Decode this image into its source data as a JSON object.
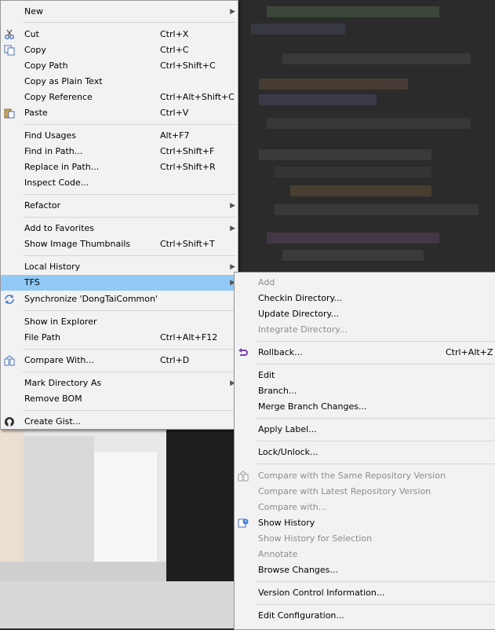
{
  "main_menu": {
    "items": [
      {
        "label": "New",
        "has_submenu": true
      },
      {
        "label": "Cut",
        "shortcut": "Ctrl+X",
        "icon": "scissors-icon"
      },
      {
        "label": "Copy",
        "shortcut": "Ctrl+C",
        "icon": "copy-icon"
      },
      {
        "label": "Copy Path",
        "shortcut": "Ctrl+Shift+C"
      },
      {
        "label": "Copy as Plain Text"
      },
      {
        "label": "Copy Reference",
        "shortcut": "Ctrl+Alt+Shift+C"
      },
      {
        "label": "Paste",
        "shortcut": "Ctrl+V",
        "icon": "paste-icon"
      },
      {
        "label": "Find Usages",
        "shortcut": "Alt+F7"
      },
      {
        "label": "Find in Path...",
        "shortcut": "Ctrl+Shift+F"
      },
      {
        "label": "Replace in Path...",
        "shortcut": "Ctrl+Shift+R"
      },
      {
        "label": "Inspect Code..."
      },
      {
        "label": "Refactor",
        "has_submenu": true
      },
      {
        "label": "Add to Favorites",
        "has_submenu": true
      },
      {
        "label": "Show Image Thumbnails",
        "shortcut": "Ctrl+Shift+T"
      },
      {
        "label": "Local History",
        "has_submenu": true
      },
      {
        "label": "TFS",
        "has_submenu": true,
        "highlighted": true
      },
      {
        "label": "Synchronize 'DongTaiCommon'",
        "icon": "sync-icon"
      },
      {
        "label": "Show in Explorer"
      },
      {
        "label": "File Path",
        "shortcut": "Ctrl+Alt+F12"
      },
      {
        "label": "Compare With...",
        "shortcut": "Ctrl+D",
        "icon": "compare-icon"
      },
      {
        "label": "Mark Directory As",
        "has_submenu": true
      },
      {
        "label": "Remove BOM"
      },
      {
        "label": "Create Gist...",
        "icon": "github-icon"
      }
    ]
  },
  "tfs_submenu": {
    "items": [
      {
        "label": "Add",
        "disabled": true
      },
      {
        "label": "Checkin Directory..."
      },
      {
        "label": "Update Directory..."
      },
      {
        "label": "Integrate Directory...",
        "disabled": true
      },
      {
        "label": "Rollback...",
        "shortcut": "Ctrl+Alt+Z",
        "icon": "rollback-icon"
      },
      {
        "label": "Edit"
      },
      {
        "label": "Branch..."
      },
      {
        "label": "Merge Branch Changes..."
      },
      {
        "label": "Apply Label..."
      },
      {
        "label": "Lock/Unlock..."
      },
      {
        "label": "Compare with the Same Repository Version",
        "disabled": true,
        "icon": "compare-icon"
      },
      {
        "label": "Compare with Latest Repository Version",
        "disabled": true
      },
      {
        "label": "Compare with...",
        "disabled": true
      },
      {
        "label": "Show History",
        "icon": "history-icon"
      },
      {
        "label": "Show History for Selection",
        "disabled": true
      },
      {
        "label": "Annotate",
        "disabled": true
      },
      {
        "label": "Browse Changes..."
      },
      {
        "label": "Version Control Information..."
      },
      {
        "label": "Edit Configuration..."
      }
    ]
  },
  "colors": {
    "menu_bg": "#f2f2f2",
    "highlight": "#91c9f7",
    "disabled_text": "#8c8c8c",
    "editor_bg": "#2b2b2b"
  }
}
